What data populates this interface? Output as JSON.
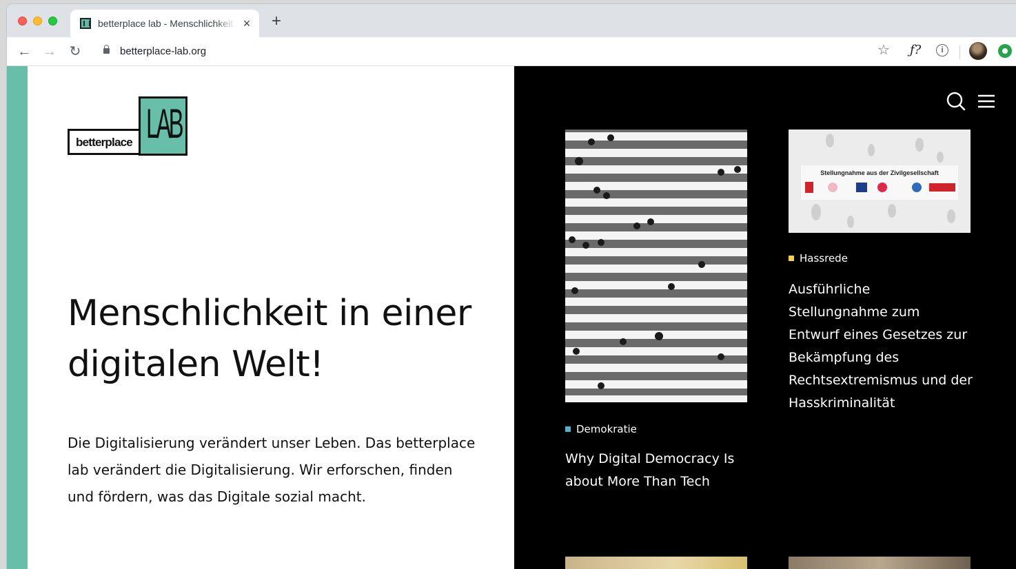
{
  "browser": {
    "tab_title": "betterplace lab - Menschlichkeit",
    "tab_close": "×",
    "new_tab": "+",
    "url": "betterplace-lab.org",
    "back": "←",
    "forward": "→",
    "reload": "↻",
    "bookmark_star": "☆",
    "extension_f": "ƒ?",
    "extension_info": "i"
  },
  "logo": {
    "word": "betterplace",
    "lab": "LAB"
  },
  "hero": {
    "title": "Menschlichkeit in einer digitalen Welt!",
    "text": "Die Digitalisierung verändert unser Leben. Das betterplace lab verändert die Digitalisierung. Wir erforschen, finden und fördern, was das Digitale sozial macht."
  },
  "cards": [
    {
      "tag": "Demokratie",
      "tag_color": "#4fb3c8",
      "title": "Why Digital Democracy Is about More Than Tech"
    },
    {
      "tag": "Hassrede",
      "tag_color": "#f2d53c",
      "image_caption": "Stellungnahme aus der Zivilgesellschaft",
      "title": "Ausführliche Stellungnahme zum Entwurf eines Gesetzes zur Bekämpfung des Rechtsextremismus und der Hasskriminalität"
    }
  ],
  "colors": {
    "accent": "#67bea9",
    "dark_panel": "#000000"
  },
  "icons": [
    "search-icon",
    "menu-icon",
    "lock-icon",
    "star-icon",
    "avatar"
  ]
}
